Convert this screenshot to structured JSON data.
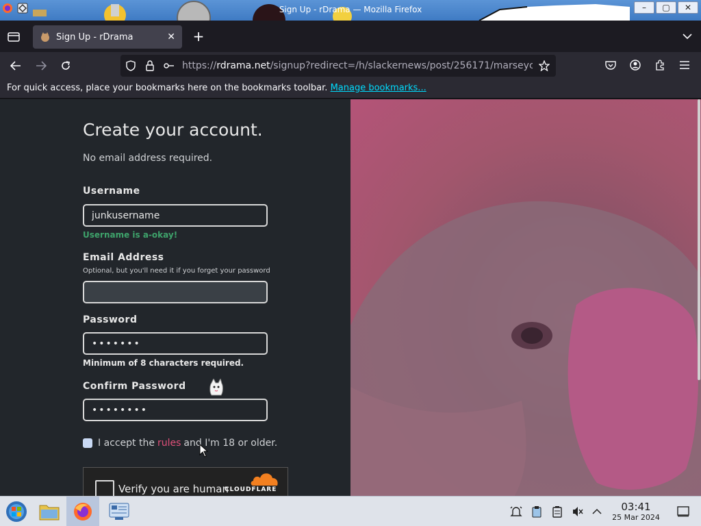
{
  "window": {
    "title": "Sign Up - rDrama — Mozilla Firefox",
    "minimize": "–",
    "maximize": "▢",
    "close": "✕"
  },
  "tabs": [
    {
      "label": "Sign Up - rDrama",
      "close": "✕",
      "icon": "marsey-favicon"
    }
  ],
  "new_tab": "+",
  "nav": {
    "url_prefix": "https://",
    "url_host": "rdrama.net",
    "url_path": "/signup?redirect=/h/slackernews/post/256171/marseyc"
  },
  "bookmarks_bar": {
    "message": "For quick access, place your bookmarks here on the bookmarks toolbar.",
    "link": "Manage bookmarks..."
  },
  "form": {
    "heading": "Create your account.",
    "subheading": "No email address required.",
    "username_label": "Username",
    "username_value": "junkusername",
    "username_status": "Username is a-okay!",
    "email_label": "Email Address",
    "email_hint": "Optional, but you'll need it if you forget your password",
    "email_value": "",
    "password_label": "Password",
    "password_value": "•••••••",
    "password_note": "Minimum of 8 characters required.",
    "confirm_label": "Confirm Password",
    "confirm_value": "••••••••",
    "accept_prefix": "I accept the",
    "accept_rules": "rules",
    "accept_suffix": "and I'm 18 or older.",
    "captcha_text": "Verify you are human",
    "captcha_brand": "CLOUDFLARE"
  },
  "taskbar": {
    "time": "03:41",
    "date": "25 Mar 2024"
  },
  "colors": {
    "accent_link": "#00ddff",
    "ok_green": "#3ea36b",
    "rules_pink": "#e0507a"
  }
}
